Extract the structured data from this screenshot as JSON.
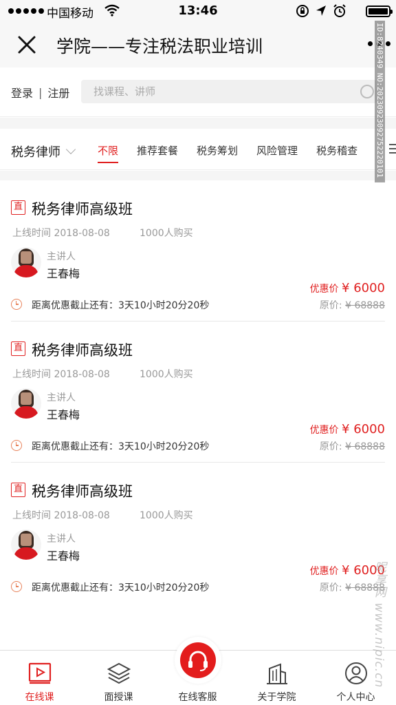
{
  "status": {
    "carrier": "中国移动",
    "time": "13:46"
  },
  "header": {
    "title": "学院——专注税法职业培训"
  },
  "auth": {
    "login": "登录",
    "separator": "|",
    "register": "注册"
  },
  "search": {
    "placeholder": "找课程、讲师"
  },
  "filter": {
    "category": "税务律师",
    "tabs": [
      "不限",
      "推荐套餐",
      "税务筹划",
      "风险管理",
      "税务稽查"
    ],
    "active_tab": 0
  },
  "courses": [
    {
      "badge": "直",
      "title": "税务律师高级班",
      "date": "上线时间 2018-08-08",
      "buyers": "1000人购买",
      "lecturer_label": "主讲人",
      "lecturer_name": "王春梅",
      "price_label": "优惠价",
      "price_now": "¥ 6000",
      "orig_label": "原价: ",
      "price_orig": "¥ 68888",
      "countdown": "距离优惠截止还有：3天10小时20分20秒"
    },
    {
      "badge": "直",
      "title": "税务律师高级班",
      "date": "上线时间 2018-08-08",
      "buyers": "1000人购买",
      "lecturer_label": "主讲人",
      "lecturer_name": "王春梅",
      "price_label": "优惠价",
      "price_now": "¥ 6000",
      "orig_label": "原价: ",
      "price_orig": "¥ 68888",
      "countdown": "距离优惠截止还有：3天10小时20分20秒"
    },
    {
      "badge": "直",
      "title": "税务律师高级班",
      "date": "上线时间 2018-08-08",
      "buyers": "1000人购买",
      "lecturer_label": "主讲人",
      "lecturer_name": "王春梅",
      "price_label": "优惠价",
      "price_now": "¥ 6000",
      "orig_label": "原价: ",
      "price_orig": "¥ 68888",
      "countdown": "距离优惠截止还有：3天10小时20分20秒"
    }
  ],
  "tabbar": [
    {
      "label": "在线课",
      "icon": "video-play-icon",
      "active": true
    },
    {
      "label": "面授课",
      "icon": "layers-icon",
      "active": false
    },
    {
      "label": "在线客服",
      "icon": "headset-icon",
      "active": false
    },
    {
      "label": "关于学院",
      "icon": "building-icon",
      "active": false
    },
    {
      "label": "个人中心",
      "icon": "user-icon",
      "active": false
    }
  ],
  "watermark": "ID:8240349 NO:20230923092752220101",
  "site_mark": "昵享网 www.nipic.cn",
  "colors": {
    "accent": "#e02020",
    "muted": "#999999",
    "background": "#f5f5f5"
  }
}
